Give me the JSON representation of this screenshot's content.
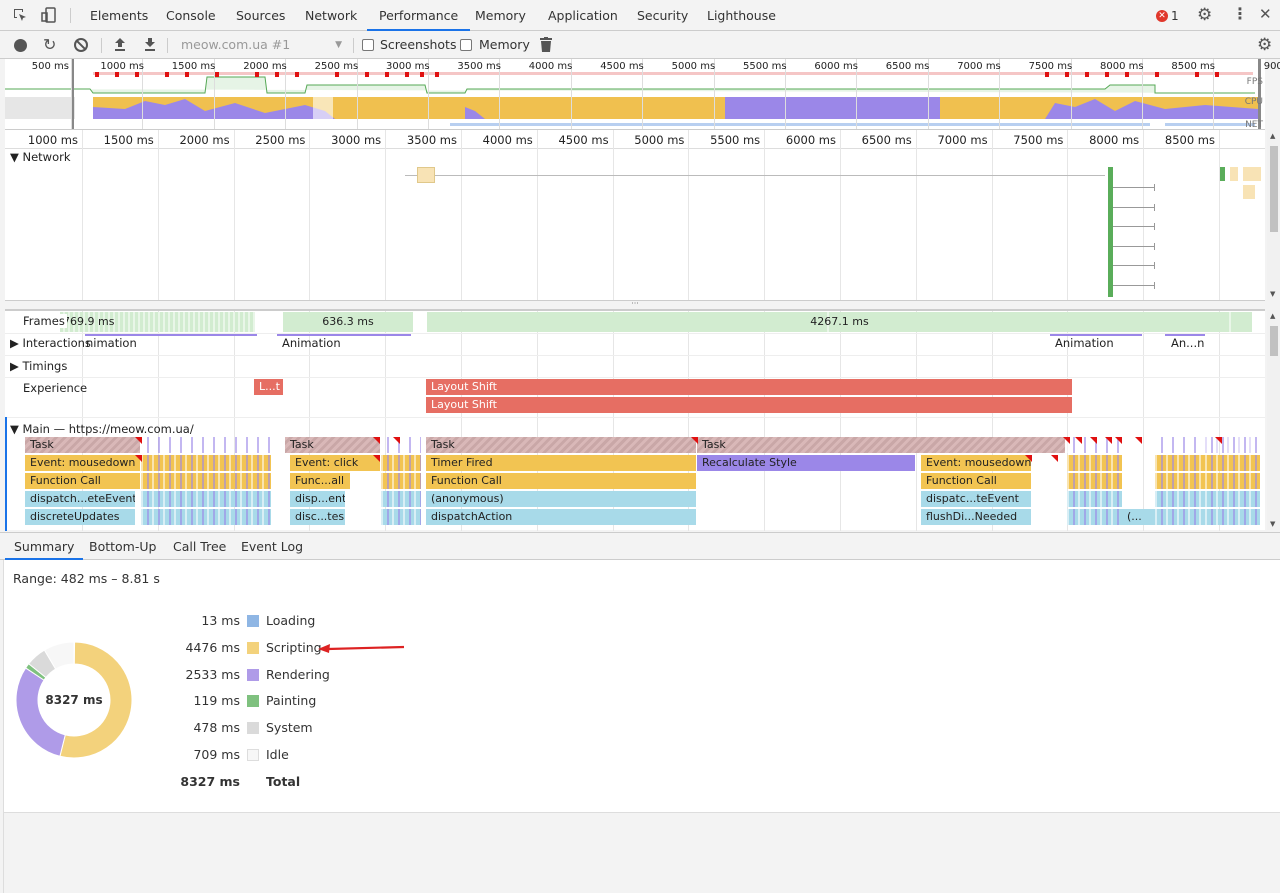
{
  "tabs": [
    "Elements",
    "Console",
    "Sources",
    "Network",
    "Performance",
    "Memory",
    "Application",
    "Security",
    "Lighthouse"
  ],
  "active_tab": "Performance",
  "error_count": "1",
  "toolbar": {
    "profile_select": "meow.com.ua #1",
    "screenshots_label": "Screenshots",
    "memory_label": "Memory"
  },
  "overview": {
    "ticks": [
      "500 ms",
      "1000 ms",
      "1500 ms",
      "2000 ms",
      "2500 ms",
      "3000 ms",
      "3500 ms",
      "4000 ms",
      "4500 ms",
      "5000 ms",
      "5500 ms",
      "6000 ms",
      "6500 ms",
      "7000 ms",
      "7500 ms",
      "8000 ms",
      "8500 ms",
      "900"
    ],
    "fps_label": "FPS",
    "cpu_label": "CPU",
    "net_label": "NET"
  },
  "ruler": {
    "ticks": [
      "1000 ms",
      "1500 ms",
      "2000 ms",
      "2500 ms",
      "3000 ms",
      "3500 ms",
      "4000 ms",
      "4500 ms",
      "5000 ms",
      "5500 ms",
      "6000 ms",
      "6500 ms",
      "7000 ms",
      "7500 ms",
      "8000 ms",
      "8500 ms",
      "900"
    ]
  },
  "tracks": {
    "network": "Network",
    "frames": "Frames",
    "interactions": "Interactions",
    "timings": "Timings",
    "experience": "Experience",
    "main": "Main — https://meow.com.ua/"
  },
  "frames": [
    "769.9 ms",
    "636.3 ms",
    "4267.1 ms"
  ],
  "interactions": [
    "nimation",
    "Animation",
    "Animation",
    "An...n"
  ],
  "experience": {
    "small": "L...t",
    "shift1": "Layout Shift",
    "shift2": "Layout Shift"
  },
  "flame": {
    "row0": [
      "Task",
      "Task",
      "Task",
      "Task"
    ],
    "row1": [
      "Event: mousedown",
      "Event: click",
      "Timer Fired",
      "Recalculate Style",
      "Event: mousedown"
    ],
    "row2": [
      "Function Call",
      "Func...all",
      "Function Call",
      "Function Call"
    ],
    "row3": [
      "dispatch...eteEvent",
      "disp...ent",
      "(anonymous)",
      "dispatc...teEvent"
    ],
    "row4": [
      "discreteUpdates",
      "disc...tes",
      "dispatchAction",
      "flushDi...Needed",
      "(..."
    ]
  },
  "bottom_tabs": [
    "Summary",
    "Bottom-Up",
    "Call Tree",
    "Event Log"
  ],
  "summary": {
    "range": "Range: 482 ms – 8.81 s",
    "donut_total": "8327 ms",
    "rows": [
      {
        "value": "13 ms",
        "label": "Loading",
        "color": "#8fb6e4"
      },
      {
        "value": "4476 ms",
        "label": "Scripting",
        "color": "#f3d27c"
      },
      {
        "value": "2533 ms",
        "label": "Rendering",
        "color": "#af9be8"
      },
      {
        "value": "119 ms",
        "label": "Painting",
        "color": "#7fc17f"
      },
      {
        "value": "478 ms",
        "label": "System",
        "color": "#dadada"
      },
      {
        "value": "709 ms",
        "label": "Idle",
        "color": "#f7f7f7"
      }
    ],
    "total_value": "8327 ms",
    "total_label": "Total"
  }
}
